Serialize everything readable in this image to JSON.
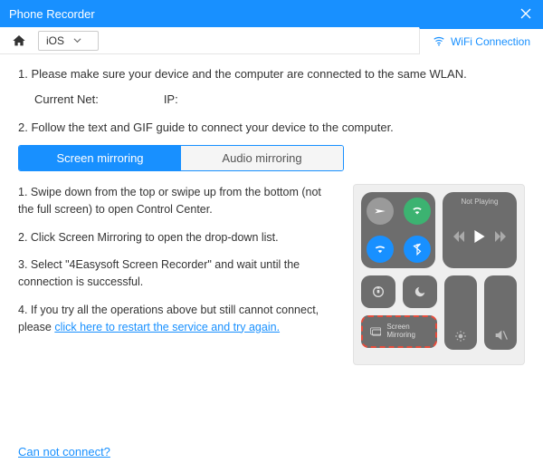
{
  "window": {
    "title": "Phone Recorder"
  },
  "toolbar": {
    "os_selected": "iOS",
    "wifi_tab": "WiFi Connection"
  },
  "instructions": {
    "step1": "1. Please make sure your device and the computer are connected to the same WLAN.",
    "current_net_label": "Current Net:",
    "current_net_value": "",
    "ip_label": "IP:",
    "ip_value": "",
    "step2": "2. Follow the text and GIF guide to connect your device to the computer."
  },
  "mirror_tabs": {
    "screen": "Screen mirroring",
    "audio": "Audio mirroring"
  },
  "steps": {
    "s1": "1. Swipe down from the top or swipe up from the bottom (not the full screen) to open Control Center.",
    "s2": "2. Click Screen Mirroring to open the drop-down list.",
    "s3": "3. Select \"4Easysoft Screen Recorder\" and wait until the connection is successful.",
    "s4_a": "4. If you try all the operations above but still cannot connect, please ",
    "s4_link": "click here to restart the service and try again."
  },
  "control_center": {
    "not_playing": "Not Playing",
    "screen_mirroring": "Screen Mirroring"
  },
  "footer": {
    "cannot_connect": "Can not connect?"
  }
}
